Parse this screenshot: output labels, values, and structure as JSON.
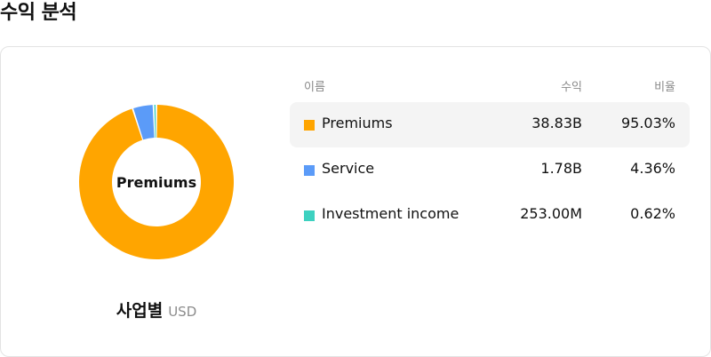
{
  "header": {
    "title": "수익 분석"
  },
  "chart_data": {
    "type": "pie",
    "center_label": "Premiums",
    "caption": "사업별",
    "unit": "USD",
    "columns": {
      "name": "이름",
      "revenue": "수익",
      "ratio": "비율"
    },
    "highlighted": "Premiums",
    "series": [
      {
        "name": "Premiums",
        "value_label": "38.83B",
        "ratio_label": "95.03%",
        "percent": 95.03,
        "color": "#FFA500"
      },
      {
        "name": "Service",
        "value_label": "1.78B",
        "ratio_label": "4.36%",
        "percent": 4.36,
        "color": "#5B9BF8"
      },
      {
        "name": "Investment income",
        "value_label": "253.00M",
        "ratio_label": "0.62%",
        "percent": 0.62,
        "color": "#3DD1C0"
      }
    ]
  }
}
